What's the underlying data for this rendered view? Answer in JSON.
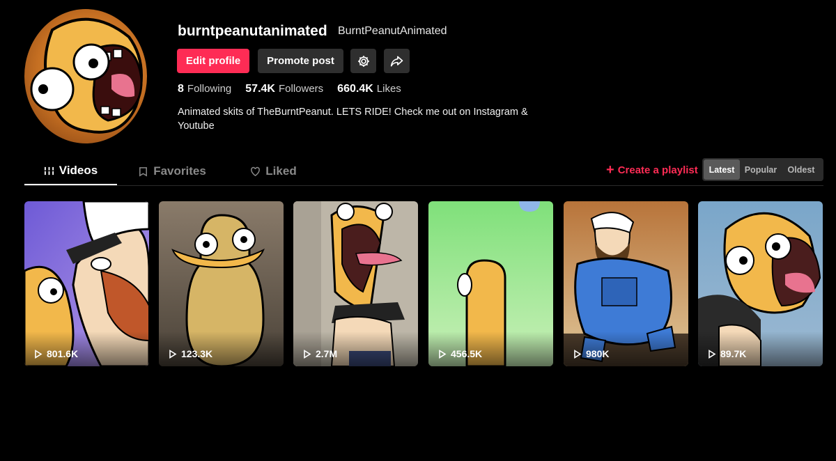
{
  "profile": {
    "username": "burntpeanutanimated",
    "nickname": "BurntPeanutAnimated",
    "bio": "Animated skits of TheBurntPeanut. LETS RIDE! Check me out on Instagram & Youtube"
  },
  "actions": {
    "edit_profile": "Edit profile",
    "promote_post": "Promote post",
    "settings_icon": "gear-icon",
    "share_icon": "share-icon"
  },
  "stats": [
    {
      "value": "8",
      "label": "Following"
    },
    {
      "value": "57.4K",
      "label": "Followers"
    },
    {
      "value": "660.4K",
      "label": "Likes"
    }
  ],
  "tabs": [
    {
      "label": "Videos",
      "icon": "grid-icon",
      "active": true
    },
    {
      "label": "Favorites",
      "icon": "bookmark-icon",
      "active": false
    },
    {
      "label": "Liked",
      "icon": "heart-icon",
      "active": false
    }
  ],
  "playlist": {
    "label": "Create a playlist"
  },
  "sort": [
    {
      "label": "Latest",
      "active": true
    },
    {
      "label": "Popular",
      "active": false
    },
    {
      "label": "Oldest",
      "active": false
    }
  ],
  "videos": [
    {
      "views": "801.6K"
    },
    {
      "views": "123.3K"
    },
    {
      "views": "2.7M"
    },
    {
      "views": "456.5K"
    },
    {
      "views": "980K"
    },
    {
      "views": "89.7K"
    }
  ],
  "colors": {
    "accent": "#fe2c55",
    "background": "#000000",
    "button_dark": "#2f2f2f"
  }
}
